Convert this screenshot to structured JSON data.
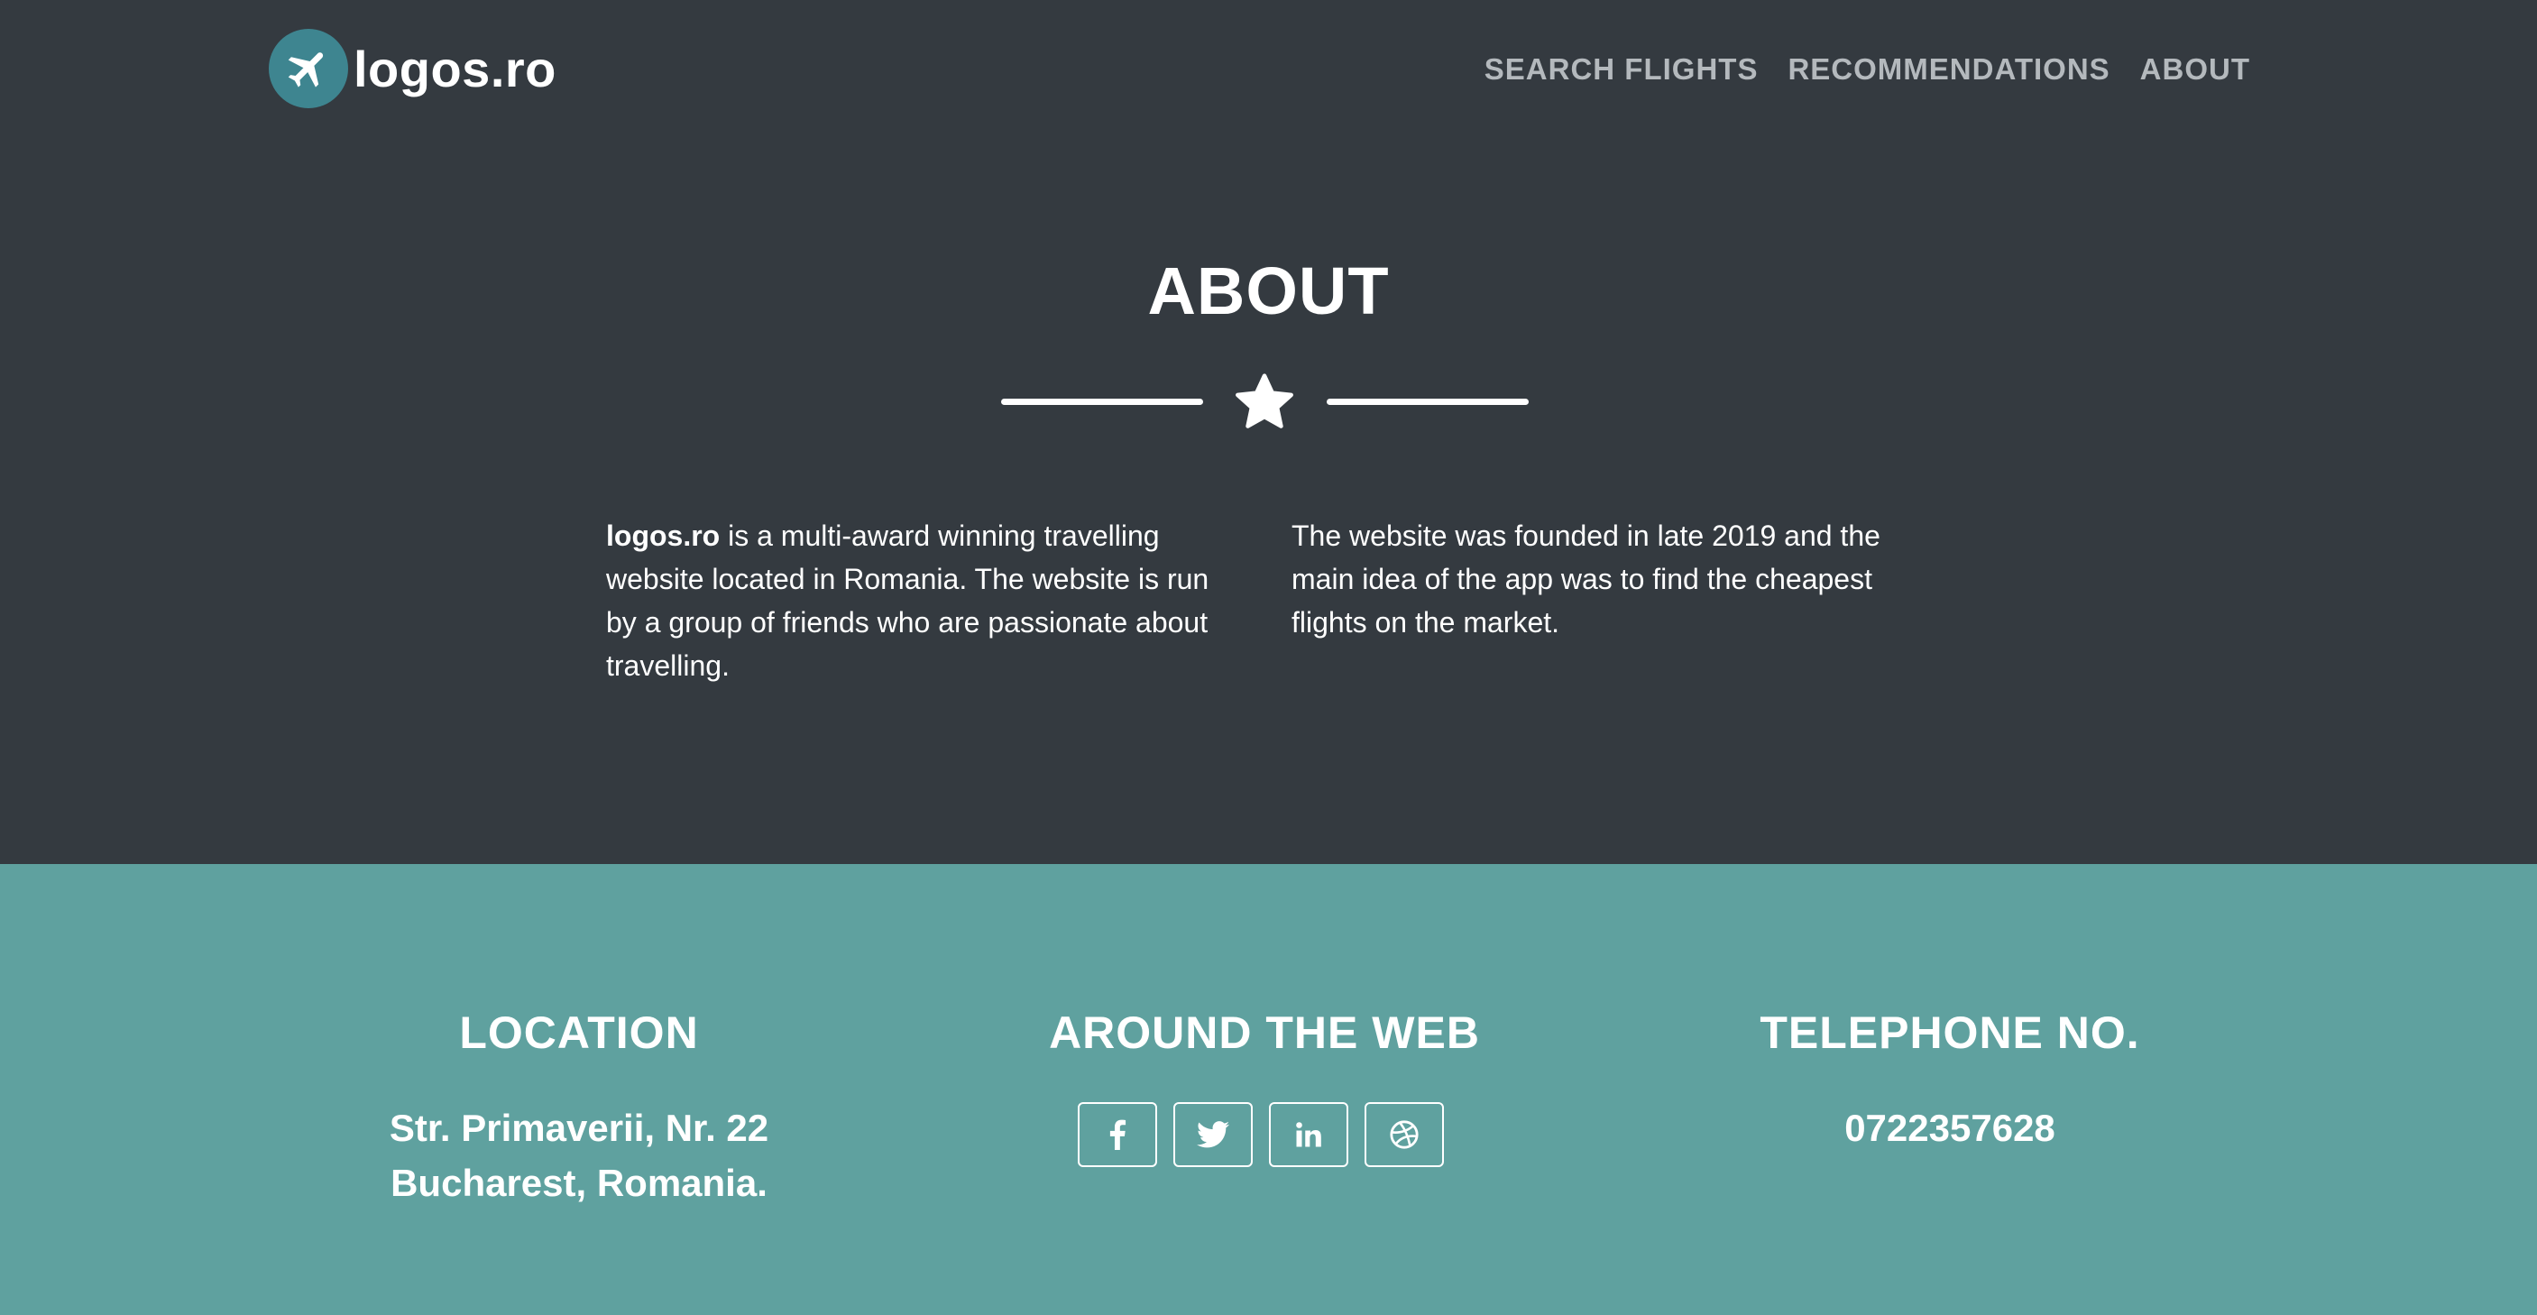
{
  "brand": {
    "name": "logos.ro"
  },
  "nav": {
    "items": [
      {
        "label": "SEARCH FLIGHTS"
      },
      {
        "label": "RECOMMENDATIONS"
      },
      {
        "label": "ABOUT"
      }
    ]
  },
  "about": {
    "title": "ABOUT",
    "left_bold": "logos.ro",
    "left_text": " is a multi-award winning travelling website located in Romania. The website is run by a group of friends who are passionate about travelling.",
    "right_text": "The website was founded in late 2019 and the main idea of the app was to find the cheapest flights on the market."
  },
  "footer": {
    "location": {
      "heading": "LOCATION",
      "line1": "Str. Primaverii, Nr. 22",
      "line2": "Bucharest, Romania."
    },
    "web": {
      "heading": "AROUND THE WEB",
      "icons": [
        "facebook-icon",
        "twitter-icon",
        "linkedin-icon",
        "dribbble-icon"
      ]
    },
    "phone": {
      "heading": "TELEPHONE NO.",
      "number": "0722357628"
    }
  },
  "colors": {
    "header_bg": "#343a40",
    "footer_bg": "#5fa19f",
    "logo_circle": "#3e8590",
    "nav_link": "#b4b9bd",
    "text": "#ffffff"
  }
}
